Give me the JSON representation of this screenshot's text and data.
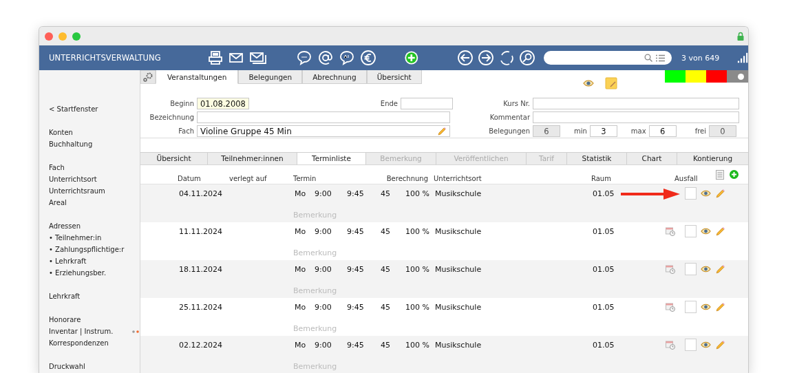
{
  "toolbar": {
    "app_title": "UNTERRICHTSVERWALTUNG",
    "record_counter": "3 von 649"
  },
  "status_strip": [
    {
      "color": "#00ff00"
    },
    {
      "color": "#ffff00"
    },
    {
      "color": "#ff0000"
    }
  ],
  "status_toggle": {
    "on": true
  },
  "sidebar": {
    "groups": [
      {
        "items": [
          {
            "label": "< Startfenster",
            "marked": false
          }
        ]
      },
      {
        "items": [
          {
            "label": "Konten",
            "marked": false
          },
          {
            "label": "Buchhaltung",
            "marked": false
          }
        ]
      },
      {
        "items": [
          {
            "label": "Fach",
            "marked": false
          },
          {
            "label": "Unterrichtsort",
            "marked": false
          },
          {
            "label": "Unterrichtsraum",
            "marked": false
          },
          {
            "label": "Areal",
            "marked": false
          }
        ]
      },
      {
        "items": [
          {
            "label": "Adressen",
            "marked": false
          },
          {
            "label": "• Teilnehmer:in",
            "marked": false
          },
          {
            "label": "• Zahlungspflichtige:r",
            "marked": false
          },
          {
            "label": "• Lehrkraft",
            "marked": false
          },
          {
            "label": "• Erziehungsber.",
            "marked": false
          }
        ]
      },
      {
        "items": [
          {
            "label": "Lehrkraft",
            "marked": false
          }
        ]
      },
      {
        "items": [
          {
            "label": "Honorare",
            "marked": false
          },
          {
            "label": "Inventar | Instrum.",
            "marked": true
          },
          {
            "label": "Korrespondenzen",
            "marked": false
          }
        ]
      },
      {
        "items": [
          {
            "label": "Druckwahl",
            "marked": false
          }
        ]
      }
    ]
  },
  "tabs": [
    {
      "label": "Veranstaltungen",
      "selected": true
    },
    {
      "label": "Belegungen",
      "selected": false
    },
    {
      "label": "Abrechnung",
      "selected": false
    },
    {
      "label": "Übersicht",
      "selected": false
    }
  ],
  "form": {
    "beginn": {
      "label": "Beginn",
      "value": "01.08.2008"
    },
    "ende": {
      "label": "Ende"
    },
    "bezeichnung": {
      "label": "Bezeichnung"
    },
    "fach": {
      "label": "Fach",
      "value": "Violine Gruppe 45 Min"
    },
    "kurs_nr": {
      "label": "Kurs Nr."
    },
    "kommentar": {
      "label": "Kommentar"
    },
    "belegungen": {
      "label": "Belegungen",
      "value": "6"
    },
    "min": {
      "label": "min",
      "value": "3"
    },
    "max": {
      "label": "max",
      "value": "6"
    },
    "frei": {
      "label": "frei",
      "value": "0"
    }
  },
  "subtabs": [
    {
      "label": "Übersicht",
      "selected": false,
      "disabled": false
    },
    {
      "label": "Teilnehmer:innen",
      "selected": false,
      "disabled": false
    },
    {
      "label": "Terminliste",
      "selected": true,
      "disabled": false
    },
    {
      "label": "Bemerkung",
      "selected": false,
      "disabled": true
    },
    {
      "label": "Veröffentlichen",
      "selected": false,
      "disabled": true
    },
    {
      "label": "Tarif",
      "selected": false,
      "disabled": true
    },
    {
      "label": "Statistik",
      "selected": false,
      "disabled": false
    },
    {
      "label": "Chart",
      "selected": false,
      "disabled": false
    },
    {
      "label": "Kontierung",
      "selected": false,
      "disabled": false
    }
  ],
  "table": {
    "columns": {
      "datum": "Datum",
      "verlegt": "verlegt auf",
      "termin": "Termin",
      "berechnung": "Berechnung",
      "ort": "Unterrichtsort",
      "raum": "Raum",
      "ausfall": "Ausfall"
    },
    "rows": [
      {
        "date": "04.11.2024",
        "day": "Mo",
        "start": "9:00",
        "end": "9:45",
        "minutes": "45",
        "percent": "100 %",
        "location": "Musikschule",
        "room": "01.05",
        "remark_placeholder": "Bemerkung",
        "calendar_icon": false,
        "cancelled": false
      },
      {
        "date": "11.11.2024",
        "day": "Mo",
        "start": "9:00",
        "end": "9:45",
        "minutes": "45",
        "percent": "100 %",
        "location": "Musikschule",
        "room": "01.05",
        "remark_placeholder": "Bemerkung",
        "calendar_icon": true,
        "cancelled": false
      },
      {
        "date": "18.11.2024",
        "day": "Mo",
        "start": "9:00",
        "end": "9:45",
        "minutes": "45",
        "percent": "100 %",
        "location": "Musikschule",
        "room": "01.05",
        "remark_placeholder": "Bemerkung",
        "calendar_icon": true,
        "cancelled": false
      },
      {
        "date": "25.11.2024",
        "day": "Mo",
        "start": "9:00",
        "end": "9:45",
        "minutes": "45",
        "percent": "100 %",
        "location": "Musikschule",
        "room": "01.05",
        "remark_placeholder": "Bemerkung",
        "calendar_icon": true,
        "cancelled": false
      },
      {
        "date": "02.12.2024",
        "day": "Mo",
        "start": "9:00",
        "end": "9:45",
        "minutes": "45",
        "percent": "100 %",
        "location": "Musikschule",
        "room": "01.05",
        "remark_placeholder": "Bemerkung",
        "calendar_icon": true,
        "cancelled": false
      }
    ]
  }
}
